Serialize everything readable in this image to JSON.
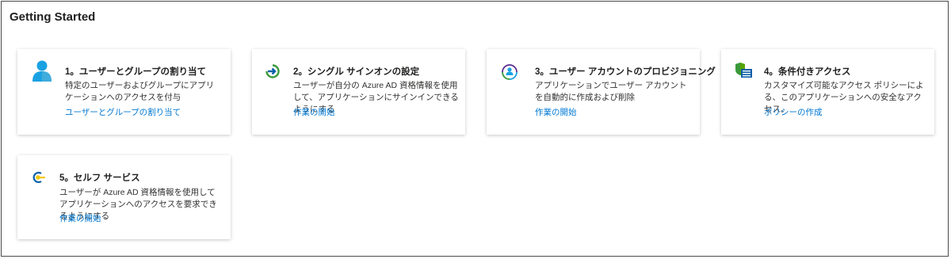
{
  "page": {
    "title": "Getting Started"
  },
  "cards": [
    {
      "title": "1。ユーザーとグループの割り当て",
      "desc": "特定のユーザーおよびグループにアプリケーションへのアクセスを付与",
      "link": "ユーザーとグループの割り当て",
      "icon": "user-icon"
    },
    {
      "title": "2。シングル サインオンの設定",
      "desc": "ユーザーが自分の Azure AD 資格情報を使用して、アプリケーションにサインインできるようにする",
      "link": "作業の開始",
      "icon": "sign-in-arrow-icon"
    },
    {
      "title": "3。ユーザー アカウントのプロビジョニング",
      "desc": "アプリケーションでユーザー アカウントを自動的に作成および削除",
      "link": "作業の開始",
      "icon": "provisioning-sync-icon"
    },
    {
      "title": "4。条件付きアクセス",
      "desc": "カスタマイズ可能なアクセス ポリシーによる、このアプリケーションへの安全なアクセス。",
      "link": "ポリシーの作成",
      "icon": "shield-list-icon"
    },
    {
      "title": "5。セルフ サービス",
      "desc": "ユーザーが Azure AD 資格情報を使用してアプリケーションへのアクセスを要求できるようにする",
      "link": "作業の開始",
      "icon": "self-service-icon"
    }
  ]
}
